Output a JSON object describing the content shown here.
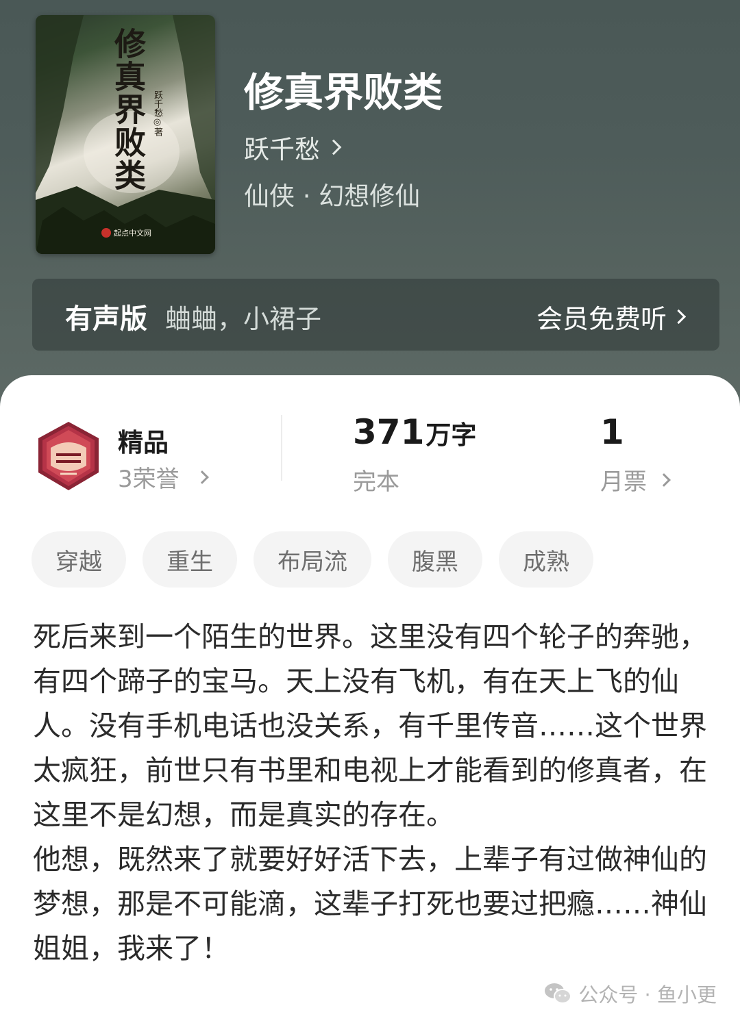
{
  "book": {
    "cover_title": "修真界败类",
    "cover_author": "跃千愁◎著",
    "cover_logo": "起点中文网",
    "title": "修真界败类",
    "author": "跃千愁",
    "genre": "仙侠 · 幻想修仙"
  },
  "audio": {
    "label": "有声版",
    "narrators": "蛐蛐，小裙子",
    "cta": "会员免费听"
  },
  "stats": {
    "honor_title": "精品",
    "honor_sub": "3荣誉",
    "word_count": "371",
    "word_unit": "万字",
    "status": "完本",
    "votes": "1",
    "votes_label": "月票"
  },
  "tags": [
    "穿越",
    "重生",
    "布局流",
    "腹黑",
    "成熟"
  ],
  "synopsis": [
    "死后来到一个陌生的世界。这里没有四个轮子的奔驰，有四个蹄子的宝马。天上没有飞机，有在天上飞的仙人。没有手机电话也没关系，有千里传音……这个世界太疯狂，前世只有书里和电视上才能看到的修真者，在这里不是幻想，而是真实的存在。",
    "他想，既然来了就要好好活下去，上辈子有过做神仙的梦想，那是不可能滴，这辈子打死也要过把瘾……神仙姐姐，我来了！"
  ],
  "watermark": "公众号 · 鱼小更",
  "colors": {
    "hero_bg": "#4e5c5a",
    "tag_bg": "#f4f4f4",
    "text_primary": "#2b2b2b",
    "text_secondary": "#9a9a9a"
  }
}
